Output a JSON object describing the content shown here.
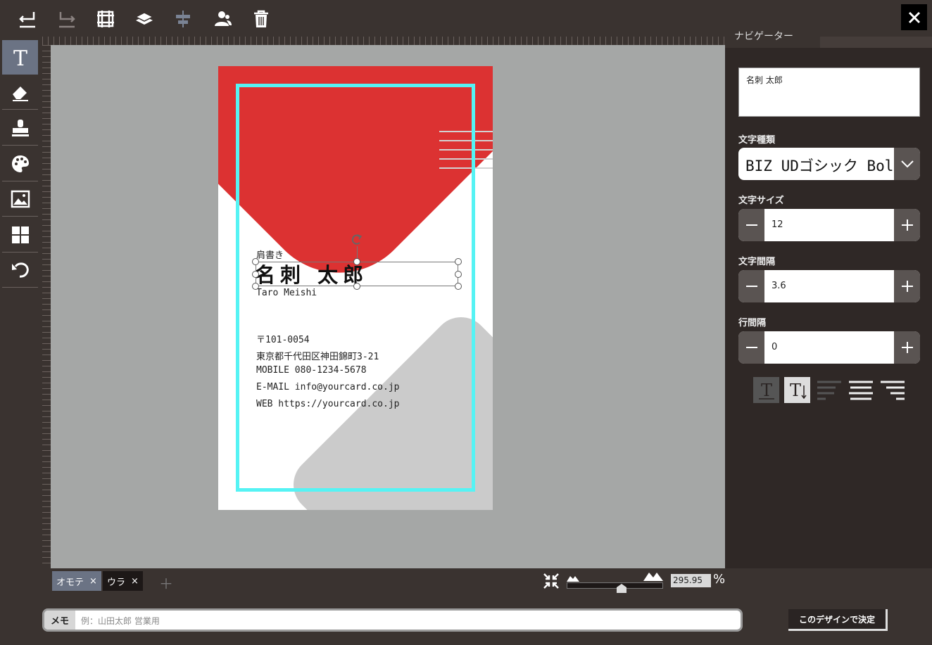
{
  "toolbar": {
    "icons": [
      "undo-icon",
      "redo-icon",
      "grid-icon",
      "layers-icon",
      "align-center-icon",
      "person-icon",
      "trash-icon"
    ]
  },
  "tools": [
    "text-tool-icon",
    "eraser-icon",
    "stamp-icon",
    "palette-icon",
    "image-icon",
    "template-icon",
    "reset-icon"
  ],
  "card": {
    "title": "肩書き",
    "name": "名刺 太郎",
    "roman_name": "Taro Meishi",
    "lines": [
      "〒101-0054",
      "東京都千代田区神田錦町3-21",
      "MOBILE 080-1234-5678",
      "E-MAIL info@yourcard.co.jp",
      "WEB https://yourcard.co.jp"
    ]
  },
  "panel": {
    "tab_label": "ナビゲーター",
    "text_value": "名刺 太郎",
    "font_label": "文字種類",
    "font_value": "BIZ UDゴシック Bold",
    "size_label": "文字サイズ",
    "size_value": "12",
    "spacing_label": "文字間隔",
    "spacing_value": "3.6",
    "line_label": "行間隔",
    "line_value": "0"
  },
  "pages": {
    "front": "オモテ",
    "back": "ウラ",
    "close_glyph": "×",
    "add_glyph": "＋"
  },
  "zoom": {
    "value": "295.95",
    "unit": "%"
  },
  "footer": {
    "memo_label": "メモ",
    "memo_placeholder": "例：山田太郎 営業用",
    "decide_label": "このデザインで決定"
  },
  "colors": {
    "accent_red": "#dc3232",
    "frame_cyan": "#55f3f4",
    "active_tool": "#6b7384"
  }
}
